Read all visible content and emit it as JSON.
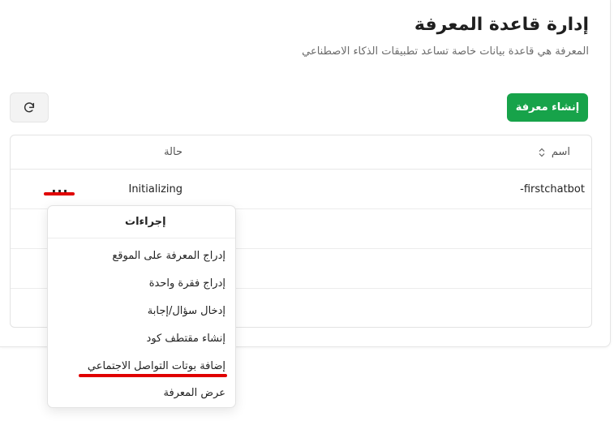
{
  "header": {
    "title": "إدارة قاعدة المعرفة",
    "subtitle": "المعرفة هي قاعدة بيانات خاصة تساعد تطبيقات الذكاء الاصطناعي"
  },
  "toolbar": {
    "create_label": "إنشاء معرفة",
    "refresh_icon": "refresh-icon"
  },
  "table": {
    "columns": {
      "name": "اسم",
      "status": "حالة"
    },
    "rows": [
      {
        "name": "-firstchatbot",
        "status": "Initializing",
        "actions": "..."
      }
    ]
  },
  "menu": {
    "title": "إجراءات",
    "items": [
      "إدراج المعرفة على الموقع",
      "إدراج فقرة واحدة",
      "إدخال سؤال/إجابة",
      "إنشاء مقتطف كود",
      "إضافة بوتات التواصل الاجتماعي",
      "عرض المعرفة"
    ]
  },
  "colors": {
    "primary": "#17a34a",
    "annotation": "#e00000"
  }
}
